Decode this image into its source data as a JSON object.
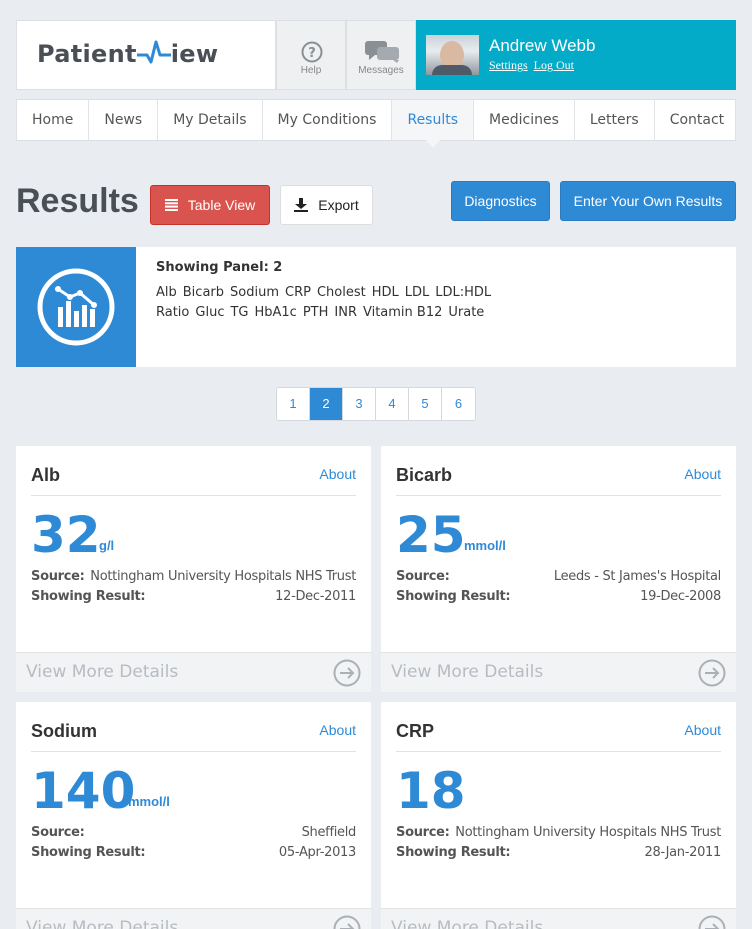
{
  "header": {
    "logo": "Patient",
    "logo_suffix": "iew",
    "help_label": "Help",
    "messages_label": "Messages",
    "user_name": "Andrew Webb",
    "settings_link": "Settings",
    "logout_link": "Log Out",
    "accent_color": "#03abc8"
  },
  "nav": {
    "items": [
      "Home",
      "News",
      "My Details",
      "My Conditions",
      "Results",
      "Medicines",
      "Letters",
      "Contact"
    ],
    "active": "Results"
  },
  "toolbar": {
    "title": "Results",
    "table_view": "Table View",
    "export": "Export",
    "diagnostics": "Diagnostics",
    "enter_results": "Enter Your Own Results"
  },
  "panel": {
    "title": "Showing Panel: 2",
    "tests": [
      "Alb",
      "Bicarb",
      "Sodium",
      "CRP",
      "Cholest",
      "HDL",
      "LDL",
      "LDL:HDL Ratio",
      "Gluc",
      "TG",
      "HbA1c",
      "PTH",
      "INR",
      "Vitamin B12",
      "Urate"
    ]
  },
  "pagination": {
    "pages": [
      "1",
      "2",
      "3",
      "4",
      "5",
      "6"
    ],
    "active": "2"
  },
  "cards": [
    {
      "name": "Alb",
      "about": "About",
      "value": "32",
      "unit": "g/l",
      "source_label": "Source:",
      "source": "Nottingham University Hospitals NHS Trust",
      "showing_label": "Showing Result:",
      "date": "12-Dec-2011",
      "footer": "View More Details"
    },
    {
      "name": "Bicarb",
      "about": "About",
      "value": "25",
      "unit": "mmol/l",
      "source_label": "Source:",
      "source": "Leeds - St James's Hospital",
      "showing_label": "Showing Result:",
      "date": "19-Dec-2008",
      "footer": "View More Details"
    },
    {
      "name": "Sodium",
      "about": "About",
      "value": "140",
      "unit": "mmol/l",
      "source_label": "Source:",
      "source": "Sheffield",
      "showing_label": "Showing Result:",
      "date": "05-Apr-2013",
      "footer": "View More Details"
    },
    {
      "name": "CRP",
      "about": "About",
      "value": "18",
      "unit": "",
      "source_label": "Source:",
      "source": "Nottingham University Hospitals NHS Trust",
      "showing_label": "Showing Result:",
      "date": "28-Jan-2011",
      "footer": "View More Details"
    }
  ]
}
